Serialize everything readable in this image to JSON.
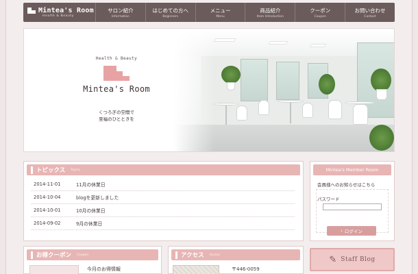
{
  "brand": {
    "name": "Mintea's Room",
    "subtitle": "Health & Beauty"
  },
  "nav": [
    {
      "jp": "サロン紹介",
      "en": "Information"
    },
    {
      "jp": "はじめての方へ",
      "en": "Beginners"
    },
    {
      "jp": "メニュー",
      "en": "Menu"
    },
    {
      "jp": "商品紹介",
      "en": "Item Introduction"
    },
    {
      "jp": "クーポン",
      "en": "Coupon"
    },
    {
      "jp": "お問い合わせ",
      "en": "Contact"
    }
  ],
  "hero": {
    "subtitle": "Health & Beauty",
    "name": "Mintea's Room",
    "tagline1": "くつろぎの空間で",
    "tagline2": "至福のひとときを"
  },
  "topics": {
    "title": "トピックス",
    "title_en": "Topics",
    "items": [
      {
        "date": "2014-11-01",
        "text": "11月の休業日"
      },
      {
        "date": "2014-10-04",
        "text": "blogを更新しました"
      },
      {
        "date": "2014-10-01",
        "text": "10月の休業日"
      },
      {
        "date": "2014-09-02",
        "text": "9月の休業日"
      }
    ]
  },
  "member": {
    "title": "Mintea's Member Room",
    "notice": "会員様へのお知らせはこちら",
    "password_label": "パスワード",
    "password_value": "",
    "login_label": "ログイン"
  },
  "coupon": {
    "title": "お得クーポン",
    "title_en": "Coupon",
    "text": "今月のお得情報"
  },
  "access": {
    "title": "アクセス",
    "title_en": "Access",
    "zip": "〒446-0059"
  },
  "staff_blog": {
    "label": "Staff Blog"
  }
}
